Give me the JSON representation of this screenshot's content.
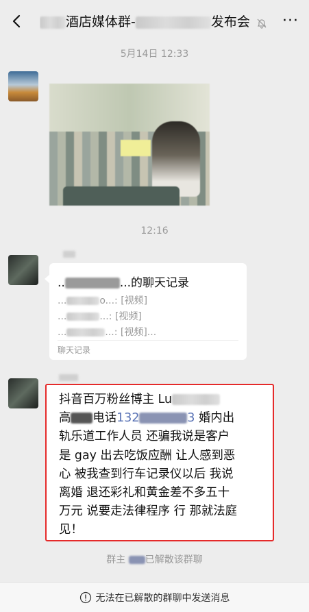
{
  "header": {
    "title_text": "酒店媒体群-",
    "title_tail": "发布会",
    "back_icon": "chevron-left-icon",
    "mute_icon": "bell-off-icon",
    "more_label": "···"
  },
  "timestamps": [
    "5月14日 12:33",
    "12:16"
  ],
  "messages": [
    {
      "type": "image"
    },
    {
      "type": "chat_record",
      "title_prefix": "..",
      "title_suffix": "...的聊天记录",
      "lines": [
        {
          "prefix": "...",
          "suffix": "o...: [视频]"
        },
        {
          "prefix": "...",
          "suffix": "...: [视频]"
        },
        {
          "prefix": "...",
          "suffix": "...: [视频]..."
        }
      ],
      "footer": "聊天记录"
    },
    {
      "type": "text",
      "l1a": "抖音百万粉丝博主 Lu",
      "l2a": "高",
      "l2b": "电话",
      "phone_a": "132",
      "phone_b": "3",
      "l2c": " 婚内出",
      "l3": "轨乐道工作人员 还骗我说是客户",
      "l4": "是 gay 出去吃饭应酬 让人感到恶",
      "l5": "心 被我查到行车记录仪以后 我说",
      "l6": "离婚 退还彩礼和黄金差不多五十",
      "l7": "万元 说要走法律程序 行 那就法庭",
      "l8": "见！"
    }
  ],
  "system": {
    "left": "群主",
    "right": "已解散该群聊"
  },
  "footer": {
    "icon": "info-icon",
    "text": "无法在已解散的群聊中发送消息"
  },
  "colors": {
    "background": "#ededed",
    "highlight_border": "#e52a2a",
    "link": "#5b74b6"
  }
}
